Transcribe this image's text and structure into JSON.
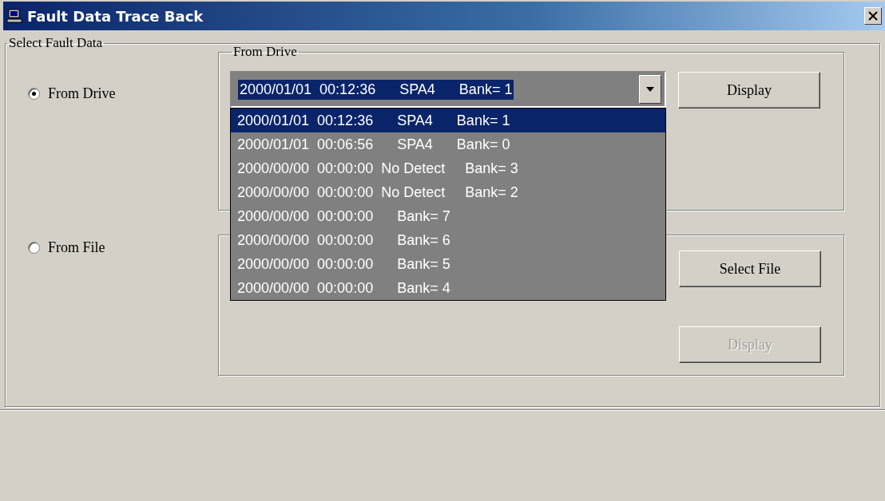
{
  "window": {
    "title": "Fault Data Trace Back"
  },
  "group": {
    "label": "Select Fault Data"
  },
  "sources": [
    {
      "label": "From Drive",
      "selected": true
    },
    {
      "label": "From File",
      "selected": false
    }
  ],
  "drive_panel": {
    "label": "From Drive",
    "combo": {
      "value": "2000/01/01  00:12:36      SPA4      Bank= 1"
    },
    "display_button": {
      "label": "Display",
      "disabled": false
    }
  },
  "dropdown": {
    "items": [
      {
        "text": "2000/01/01  00:12:36      SPA4      Bank= 1",
        "selected": true
      },
      {
        "text": "2000/01/01  00:06:56      SPA4      Bank= 0",
        "selected": false
      },
      {
        "text": "2000/00/00  00:00:00  No Detect     Bank= 3",
        "selected": false
      },
      {
        "text": "2000/00/00  00:00:00  No Detect     Bank= 2",
        "selected": false
      },
      {
        "text": "2000/00/00  00:00:00      Bank= 7",
        "selected": false
      },
      {
        "text": "2000/00/00  00:00:00      Bank= 6",
        "selected": false
      },
      {
        "text": "2000/00/00  00:00:00      Bank= 5",
        "selected": false
      },
      {
        "text": "2000/00/00  00:00:00      Bank= 4",
        "selected": false
      }
    ]
  },
  "file_panel": {
    "select_button": {
      "label": "Select File",
      "disabled": false
    },
    "display_button": {
      "label": "Display",
      "disabled": true
    }
  }
}
